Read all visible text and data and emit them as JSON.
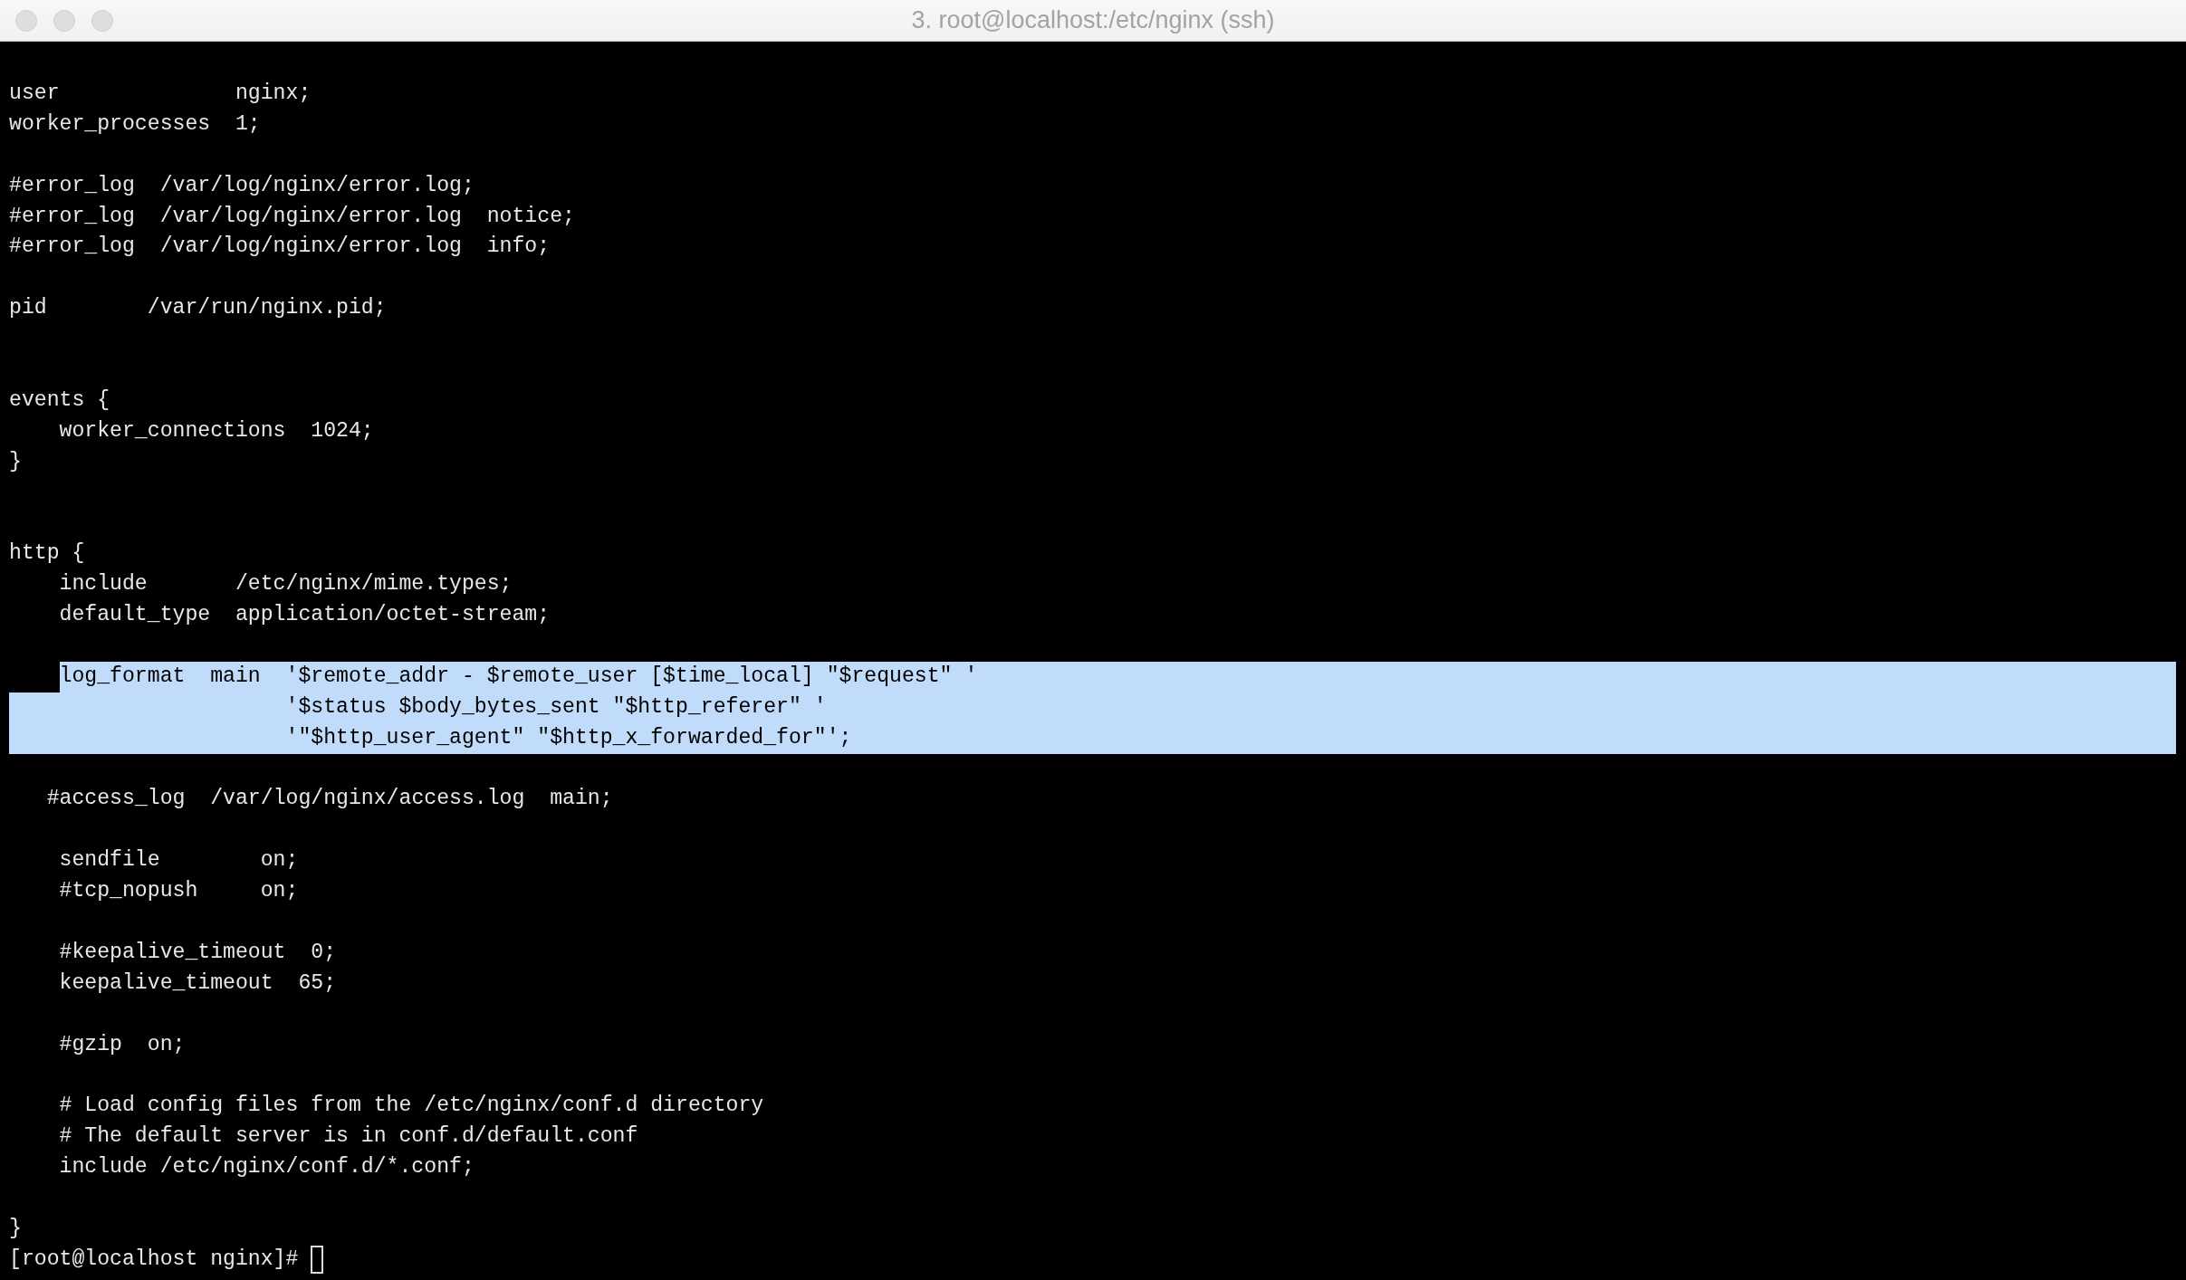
{
  "window": {
    "title": "3. root@localhost:/etc/nginx (ssh)",
    "focused": false
  },
  "terminal": {
    "lines": [
      {
        "kind": "code",
        "text": "user              nginx;",
        "selected": false
      },
      {
        "kind": "code",
        "text": "worker_processes  1;",
        "selected": false
      },
      {
        "kind": "blank",
        "selected": false
      },
      {
        "kind": "code",
        "text": "#error_log  /var/log/nginx/error.log;",
        "selected": false
      },
      {
        "kind": "code",
        "text": "#error_log  /var/log/nginx/error.log  notice;",
        "selected": false
      },
      {
        "kind": "code",
        "text": "#error_log  /var/log/nginx/error.log  info;",
        "selected": false
      },
      {
        "kind": "blank",
        "selected": false
      },
      {
        "kind": "code",
        "text": "pid        /var/run/nginx.pid;",
        "selected": false
      },
      {
        "kind": "blank",
        "selected": false
      },
      {
        "kind": "blank",
        "selected": false
      },
      {
        "kind": "code",
        "text": "events {",
        "selected": false
      },
      {
        "kind": "code",
        "text": "    worker_connections  1024;",
        "selected": false
      },
      {
        "kind": "code",
        "text": "}",
        "selected": false
      },
      {
        "kind": "blank",
        "selected": false
      },
      {
        "kind": "blank",
        "selected": false
      },
      {
        "kind": "code",
        "text": "http {",
        "selected": false
      },
      {
        "kind": "code",
        "text": "    include       /etc/nginx/mime.types;",
        "selected": false
      },
      {
        "kind": "code",
        "text": "    default_type  application/octet-stream;",
        "selected": false
      },
      {
        "kind": "blank",
        "selected": false
      },
      {
        "kind": "code",
        "text": "    log_format  main  '$remote_addr - $remote_user [$time_local] \"$request\" '",
        "selected": true
      },
      {
        "kind": "code",
        "text": "                      '$status $body_bytes_sent \"$http_referer\" '",
        "selected": true
      },
      {
        "kind": "code",
        "text": "                      '\"$http_user_agent\" \"$http_x_forwarded_for\"';",
        "selected": true
      },
      {
        "kind": "blank",
        "selected": false
      },
      {
        "kind": "code",
        "text": "   #access_log  /var/log/nginx/access.log  main;",
        "selected": false
      },
      {
        "kind": "blank",
        "selected": false
      },
      {
        "kind": "code",
        "text": "    sendfile        on;",
        "selected": false
      },
      {
        "kind": "code",
        "text": "    #tcp_nopush     on;",
        "selected": false
      },
      {
        "kind": "blank",
        "selected": false
      },
      {
        "kind": "code",
        "text": "    #keepalive_timeout  0;",
        "selected": false
      },
      {
        "kind": "code",
        "text": "    keepalive_timeout  65;",
        "selected": false
      },
      {
        "kind": "blank",
        "selected": false
      },
      {
        "kind": "code",
        "text": "    #gzip  on;",
        "selected": false
      },
      {
        "kind": "blank",
        "selected": false
      },
      {
        "kind": "code",
        "text": "    # Load config files from the /etc/nginx/conf.d directory",
        "selected": false
      },
      {
        "kind": "code",
        "text": "    # The default server is in conf.d/default.conf",
        "selected": false
      },
      {
        "kind": "code",
        "text": "    include /etc/nginx/conf.d/*.conf;",
        "selected": false
      },
      {
        "kind": "blank",
        "selected": false
      },
      {
        "kind": "code",
        "text": "}",
        "selected": false
      },
      {
        "kind": "prompt",
        "text": "[root@localhost nginx]#",
        "selected": false
      }
    ]
  }
}
